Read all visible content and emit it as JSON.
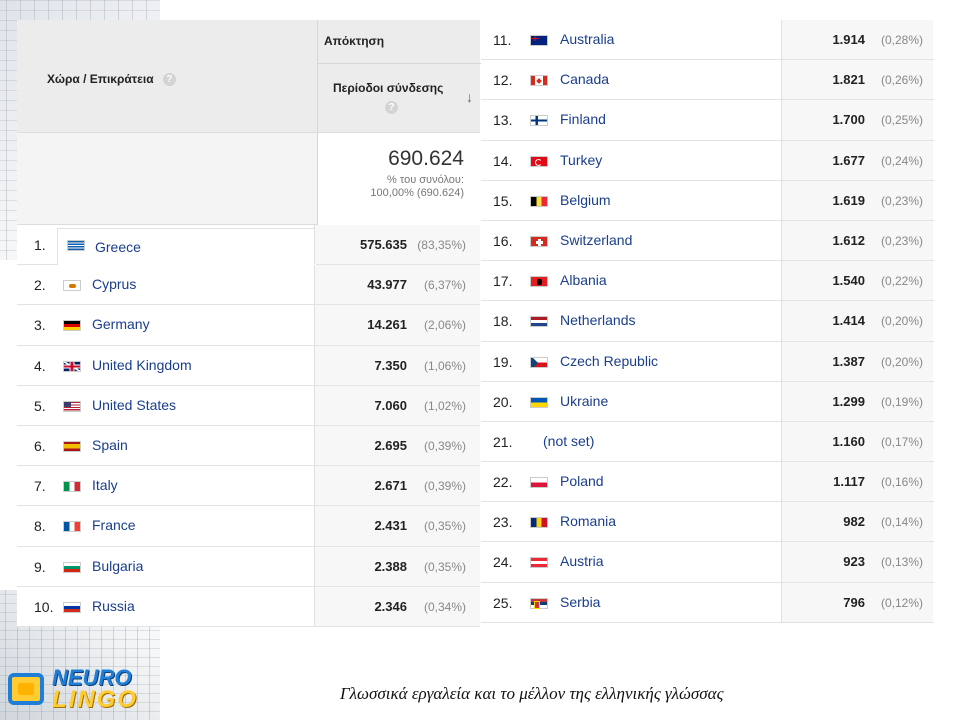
{
  "header": {
    "country_label": "Χώρα / Επικράτεια",
    "acquisition_label": "Απόκτηση",
    "sessions_label": "Περίοδοι σύνδεσης",
    "help_glyph": "?",
    "sort_glyph": "↓"
  },
  "total": {
    "value": "690.624",
    "pct_label": "% του συνόλου:",
    "pct_value": "100,00% (690.624)"
  },
  "rows_left": [
    {
      "rank": "1.",
      "country": "Greece",
      "flag": "gr",
      "sessions": "575.635",
      "pct": "(83,35%)"
    },
    {
      "rank": "2.",
      "country": "Cyprus",
      "flag": "cy",
      "sessions": "43.977",
      "pct": "(6,37%)"
    },
    {
      "rank": "3.",
      "country": "Germany",
      "flag": "de",
      "sessions": "14.261",
      "pct": "(2,06%)"
    },
    {
      "rank": "4.",
      "country": "United Kingdom",
      "flag": "uk",
      "sessions": "7.350",
      "pct": "(1,06%)"
    },
    {
      "rank": "5.",
      "country": "United States",
      "flag": "us",
      "sessions": "7.060",
      "pct": "(1,02%)"
    },
    {
      "rank": "6.",
      "country": "Spain",
      "flag": "es",
      "sessions": "2.695",
      "pct": "(0,39%)"
    },
    {
      "rank": "7.",
      "country": "Italy",
      "flag": "it",
      "sessions": "2.671",
      "pct": "(0,39%)"
    },
    {
      "rank": "8.",
      "country": "France",
      "flag": "fr",
      "sessions": "2.431",
      "pct": "(0,35%)"
    },
    {
      "rank": "9.",
      "country": "Bulgaria",
      "flag": "bg",
      "sessions": "2.388",
      "pct": "(0,35%)"
    },
    {
      "rank": "10.",
      "country": "Russia",
      "flag": "ru",
      "sessions": "2.346",
      "pct": "(0,34%)"
    }
  ],
  "rows_right": [
    {
      "rank": "11.",
      "country": "Australia",
      "flag": "au",
      "sessions": "1.914",
      "pct": "(0,28%)"
    },
    {
      "rank": "12.",
      "country": "Canada",
      "flag": "ca",
      "sessions": "1.821",
      "pct": "(0,26%)"
    },
    {
      "rank": "13.",
      "country": "Finland",
      "flag": "fi",
      "sessions": "1.700",
      "pct": "(0,25%)"
    },
    {
      "rank": "14.",
      "country": "Turkey",
      "flag": "tr",
      "sessions": "1.677",
      "pct": "(0,24%)"
    },
    {
      "rank": "15.",
      "country": "Belgium",
      "flag": "be",
      "sessions": "1.619",
      "pct": "(0,23%)"
    },
    {
      "rank": "16.",
      "country": "Switzerland",
      "flag": "ch",
      "sessions": "1.612",
      "pct": "(0,23%)"
    },
    {
      "rank": "17.",
      "country": "Albania",
      "flag": "al",
      "sessions": "1.540",
      "pct": "(0,22%)"
    },
    {
      "rank": "18.",
      "country": "Netherlands",
      "flag": "nl",
      "sessions": "1.414",
      "pct": "(0,20%)"
    },
    {
      "rank": "19.",
      "country": "Czech Republic",
      "flag": "cz",
      "sessions": "1.387",
      "pct": "(0,20%)"
    },
    {
      "rank": "20.",
      "country": "Ukraine",
      "flag": "ua",
      "sessions": "1.299",
      "pct": "(0,19%)"
    },
    {
      "rank": "21.",
      "country": "(not set)",
      "flag": "",
      "sessions": "1.160",
      "pct": "(0,17%)"
    },
    {
      "rank": "22.",
      "country": "Poland",
      "flag": "pl",
      "sessions": "1.117",
      "pct": "(0,16%)"
    },
    {
      "rank": "23.",
      "country": "Romania",
      "flag": "ro",
      "sessions": "982",
      "pct": "(0,14%)"
    },
    {
      "rank": "24.",
      "country": "Austria",
      "flag": "at",
      "sessions": "923",
      "pct": "(0,13%)"
    },
    {
      "rank": "25.",
      "country": "Serbia",
      "flag": "rs",
      "sessions": "796",
      "pct": "(0,12%)"
    }
  ],
  "logo": {
    "word1": "NEURO",
    "word2": "LINGO"
  },
  "footer_text": "Γλωσσικά εργαλεία και το μέλλον της ελληνικής γλώσσας",
  "colors": {
    "link": "#1a3e8c",
    "header_bg": "#ececec",
    "logo_blue": "#1f7fd6",
    "logo_yellow": "#ffcc33"
  }
}
